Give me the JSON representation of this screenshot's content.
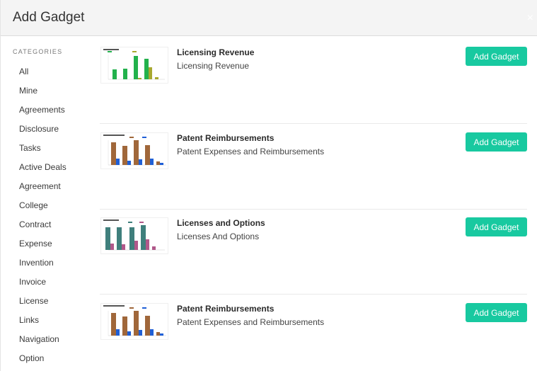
{
  "header": {
    "title": "Add Gadget",
    "close_icon": "×"
  },
  "sidebar": {
    "categories_title": "CATEGORIES",
    "items": [
      "All",
      "Mine",
      "Agreements",
      "Disclosure",
      "Tasks",
      "Active Deals",
      "Agreement",
      "College",
      "Contract",
      "Expense",
      "Invention",
      "Invoice",
      "License",
      "Links",
      "Navigation",
      "Option"
    ]
  },
  "colors": {
    "accent": "#18c9a0",
    "green_bar": "#22b14c",
    "brown_bar": "#a0673a",
    "blue_bar": "#1f5fd6",
    "teal_bar": "#3f7f7c",
    "pink_bar": "#b0588a"
  },
  "gadgets": [
    {
      "name": "Licensing Revenue",
      "description": "Licensing Revenue",
      "button": "Add Gadget",
      "thumbnail": "green-bar-chart-icon"
    },
    {
      "name": "Patent Reimbursements",
      "description": "Patent Expenses and Reimbursements",
      "button": "Add Gadget",
      "thumbnail": "brown-blue-bar-chart-icon"
    },
    {
      "name": "Licenses and Options",
      "description": "Licenses And Options",
      "button": "Add Gadget",
      "thumbnail": "teal-pink-bar-chart-icon"
    },
    {
      "name": "Patent Reimbursements",
      "description": "Patent Expenses and Reimbursements",
      "button": "Add Gadget",
      "thumbnail": "brown-blue-bar-chart-icon"
    }
  ]
}
